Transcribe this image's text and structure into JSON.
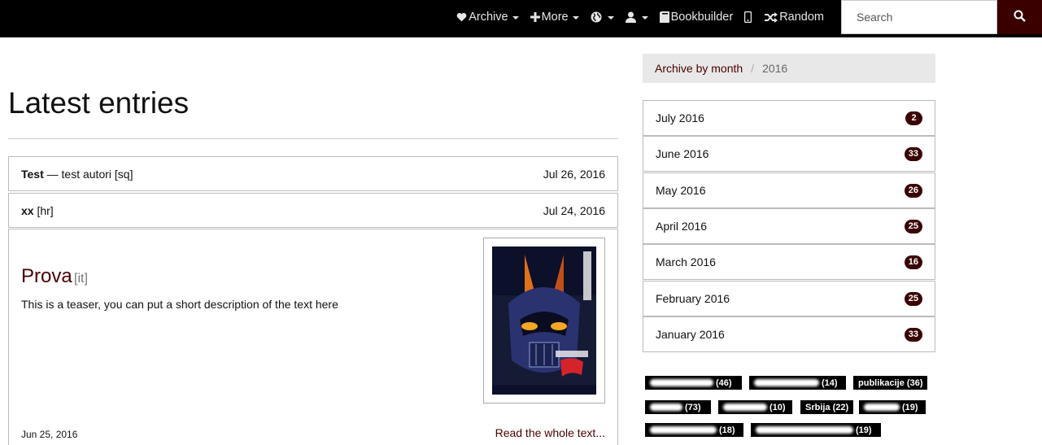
{
  "navbar": {
    "items": [
      {
        "label": "Archive",
        "icon": "heart-icon",
        "dropdown": true
      },
      {
        "label": "More",
        "icon": "plus-icon",
        "dropdown": true
      },
      {
        "label": "",
        "icon": "globe-icon",
        "dropdown": true
      },
      {
        "label": "",
        "icon": "user-icon",
        "dropdown": true
      },
      {
        "label": "Bookbuilder",
        "icon": "book-icon",
        "dropdown": false
      },
      {
        "label": "",
        "icon": "mobile-icon",
        "dropdown": false
      },
      {
        "label": "Random",
        "icon": "shuffle-icon",
        "dropdown": false
      }
    ],
    "search_placeholder": "Search"
  },
  "main": {
    "title": "Latest entries",
    "entries": [
      {
        "title": "Test",
        "suffix": " — test autori [sq]",
        "date": "Jul 26, 2016"
      },
      {
        "title": "xx",
        "suffix": " [hr]",
        "date": "Jul 24, 2016"
      }
    ],
    "featured": {
      "title": "Prova",
      "lang": "[it]",
      "teaser": "This is a teaser, you can put a short description of the text here",
      "date": "Jun 25, 2016",
      "read_more": "Read the whole text..."
    }
  },
  "sidebar": {
    "breadcrumb": {
      "link": "Archive by month",
      "separator": "/",
      "current": "2016"
    },
    "months": [
      {
        "label": "July 2016",
        "count": "2"
      },
      {
        "label": "June 2016",
        "count": "33"
      },
      {
        "label": "May 2016",
        "count": "26"
      },
      {
        "label": "April 2016",
        "count": "25"
      },
      {
        "label": "March 2016",
        "count": "16"
      },
      {
        "label": "February 2016",
        "count": "25"
      },
      {
        "label": "January 2016",
        "count": "33"
      }
    ],
    "tags": [
      {
        "label": "",
        "count": "(46)"
      },
      {
        "label": "",
        "count": "(14)"
      },
      {
        "label": "publikacije",
        "count": "(36)"
      },
      {
        "label": "",
        "count": "(73)"
      },
      {
        "label": "",
        "count": "(10)"
      },
      {
        "label": "Srbija",
        "count": "(22)"
      },
      {
        "label": "",
        "count": "(19)"
      },
      {
        "label": "",
        "count": "(18)"
      },
      {
        "label": "",
        "count": "(19)"
      }
    ]
  },
  "colors": {
    "accent": "#3a0000",
    "link": "#4a0000",
    "navbar": "#000000"
  }
}
